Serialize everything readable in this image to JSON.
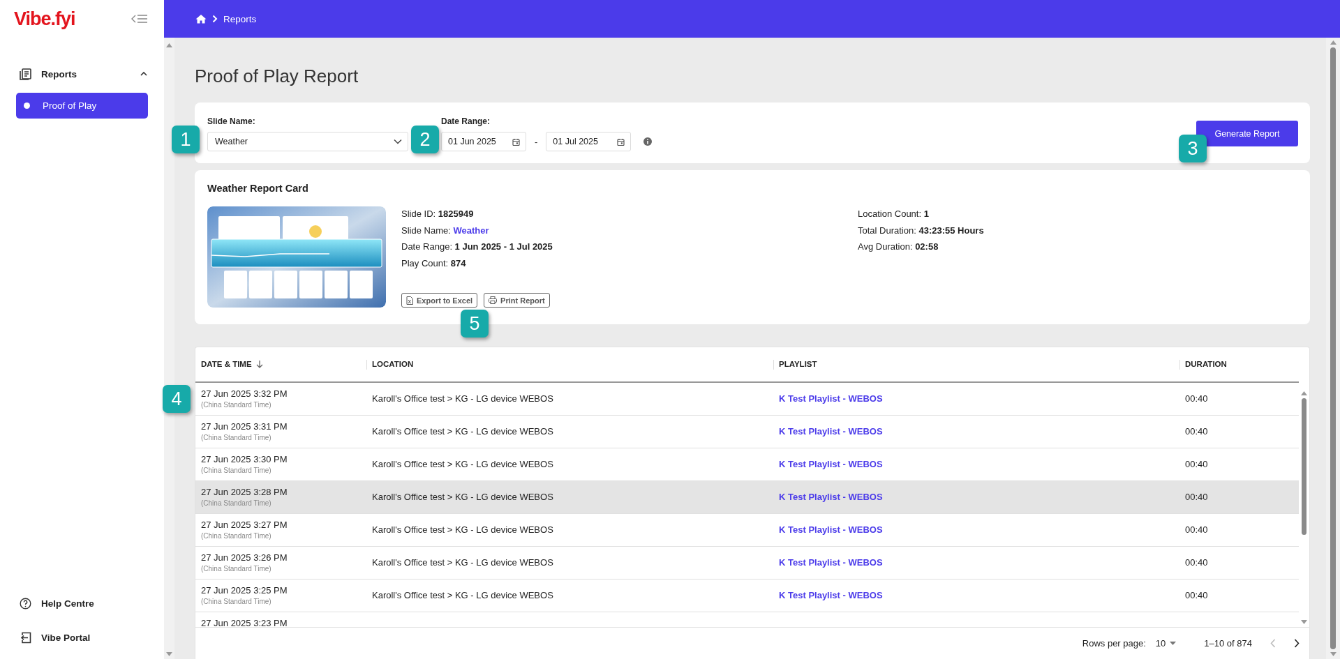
{
  "sidebar": {
    "logo": "Vibe.fyi",
    "nav": [
      {
        "label": "Reports",
        "expanded": true,
        "children": [
          {
            "label": "Proof of Play",
            "selected": true
          }
        ]
      }
    ],
    "footer_links": [
      {
        "label": "Help Centre",
        "kind": "help"
      },
      {
        "label": "Vibe Portal",
        "kind": "portal"
      }
    ]
  },
  "breadcrumb": [
    "Reports"
  ],
  "page_title": "Proof of Play Report",
  "filters": {
    "slide_name": {
      "label": "Slide Name:",
      "value": "Weather"
    },
    "date_range": {
      "label": "Date Range:",
      "from": "01 Jun 2025",
      "separator": "-",
      "to": "01 Jul 2025"
    },
    "generate_button": "Generate Report"
  },
  "report_card": {
    "title": "Weather Report Card",
    "details_left": [
      {
        "label": "Slide ID:",
        "value": "1825949",
        "kind": "plain"
      },
      {
        "label": "Slide Name:",
        "value": "Weather",
        "kind": "link"
      },
      {
        "label": "Date Range:",
        "value": "1 Jun 2025 - 1 Jul 2025",
        "kind": "plain"
      },
      {
        "label": "Play Count:",
        "value": "874",
        "kind": "plain"
      }
    ],
    "details_right": [
      {
        "label": "Location Count:",
        "value": "1",
        "kind": "plain"
      },
      {
        "label": "Total Duration:",
        "value": "43:23:55 Hours",
        "kind": "plain"
      },
      {
        "label": "Avg Duration:",
        "value": "02:58",
        "kind": "plain"
      }
    ],
    "actions": [
      {
        "label": "Export to Excel",
        "kind": "excel"
      },
      {
        "label": "Print Report",
        "kind": "print"
      }
    ]
  },
  "table": {
    "columns": [
      {
        "label": "DATE & TIME",
        "sorted": true
      },
      {
        "label": "LOCATION",
        "sorted": false
      },
      {
        "label": "PLAYLIST",
        "sorted": false
      },
      {
        "label": "DURATION",
        "sorted": false
      }
    ],
    "rows": [
      {
        "date": "27 Jun 2025 3:32 PM",
        "timezone": "(China Standard Time)",
        "location": "Karoll's Office test > KG - LG device WEBOS",
        "playlist": "K Test Playlist - WEBOS",
        "duration": "00:40",
        "highlighted": false
      },
      {
        "date": "27 Jun 2025 3:31 PM",
        "timezone": "(China Standard Time)",
        "location": "Karoll's Office test > KG - LG device WEBOS",
        "playlist": "K Test Playlist - WEBOS",
        "duration": "00:40",
        "highlighted": false
      },
      {
        "date": "27 Jun 2025 3:30 PM",
        "timezone": "(China Standard Time)",
        "location": "Karoll's Office test > KG - LG device WEBOS",
        "playlist": "K Test Playlist - WEBOS",
        "duration": "00:40",
        "highlighted": false
      },
      {
        "date": "27 Jun 2025 3:28 PM",
        "timezone": "(China Standard Time)",
        "location": "Karoll's Office test > KG - LG device WEBOS",
        "playlist": "K Test Playlist - WEBOS",
        "duration": "00:40",
        "highlighted": true
      },
      {
        "date": "27 Jun 2025 3:27 PM",
        "timezone": "(China Standard Time)",
        "location": "Karoll's Office test > KG - LG device WEBOS",
        "playlist": "K Test Playlist - WEBOS",
        "duration": "00:40",
        "highlighted": false
      },
      {
        "date": "27 Jun 2025 3:26 PM",
        "timezone": "(China Standard Time)",
        "location": "Karoll's Office test > KG - LG device WEBOS",
        "playlist": "K Test Playlist - WEBOS",
        "duration": "00:40",
        "highlighted": false
      },
      {
        "date": "27 Jun 2025 3:25 PM",
        "timezone": "(China Standard Time)",
        "location": "Karoll's Office test > KG - LG device WEBOS",
        "playlist": "K Test Playlist - WEBOS",
        "duration": "00:40",
        "highlighted": false
      },
      {
        "date": "27 Jun 2025 3:23 PM",
        "highlighted": false
      }
    ],
    "pagination": {
      "rows_per_page_label": "Rows per page:",
      "rows_per_page": "10",
      "range": "1–10 of 874",
      "prev_disabled": true,
      "next_disabled": false
    }
  },
  "callouts": [
    {
      "label": "1"
    },
    {
      "label": "2"
    },
    {
      "label": "3"
    },
    {
      "label": "4"
    },
    {
      "label": "5"
    }
  ]
}
